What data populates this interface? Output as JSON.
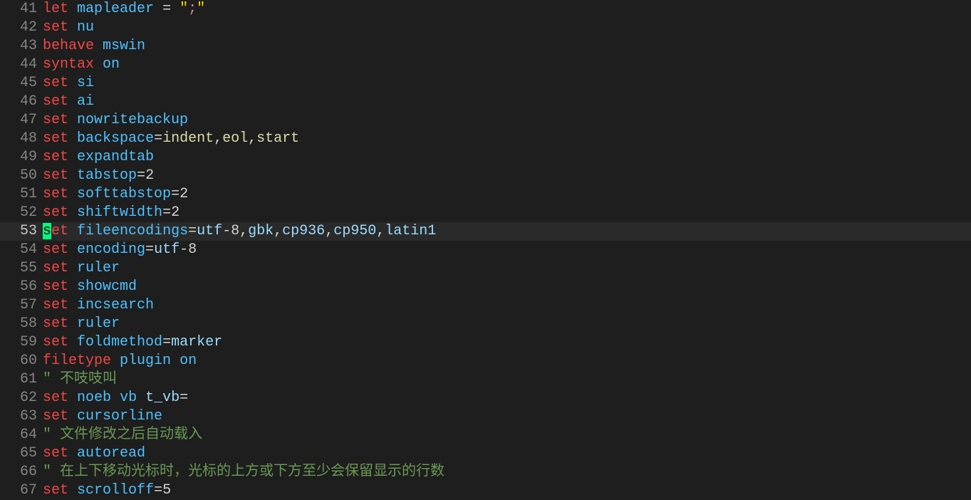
{
  "editor": {
    "current_line": 53,
    "first_line": 41,
    "lines": [
      {
        "n": 41,
        "tokens": [
          [
            "kw",
            "let"
          ],
          [
            "plain",
            " "
          ],
          [
            "opt",
            "mapleader"
          ],
          [
            "plain",
            " "
          ],
          [
            "op",
            "="
          ],
          [
            "plain",
            " "
          ],
          [
            "brk",
            "\""
          ],
          [
            "str",
            ";"
          ],
          [
            "brk",
            "\""
          ]
        ]
      },
      {
        "n": 42,
        "tokens": [
          [
            "kw",
            "set"
          ],
          [
            "plain",
            " "
          ],
          [
            "opt",
            "nu"
          ]
        ]
      },
      {
        "n": 43,
        "tokens": [
          [
            "kw",
            "behave"
          ],
          [
            "plain",
            " "
          ],
          [
            "opt",
            "mswin"
          ]
        ]
      },
      {
        "n": 44,
        "tokens": [
          [
            "kw",
            "syntax"
          ],
          [
            "plain",
            " "
          ],
          [
            "opt",
            "on"
          ]
        ]
      },
      {
        "n": 45,
        "tokens": [
          [
            "kw",
            "set"
          ],
          [
            "plain",
            " "
          ],
          [
            "opt",
            "si"
          ]
        ]
      },
      {
        "n": 46,
        "tokens": [
          [
            "kw",
            "set"
          ],
          [
            "plain",
            " "
          ],
          [
            "opt",
            "ai"
          ]
        ]
      },
      {
        "n": 47,
        "tokens": [
          [
            "kw",
            "set"
          ],
          [
            "plain",
            " "
          ],
          [
            "opt",
            "nowritebackup"
          ]
        ]
      },
      {
        "n": 48,
        "tokens": [
          [
            "kw",
            "set"
          ],
          [
            "plain",
            " "
          ],
          [
            "opt",
            "backspace"
          ],
          [
            "op",
            "="
          ],
          [
            "fn",
            "indent"
          ],
          [
            "op",
            ","
          ],
          [
            "fn",
            "eol"
          ],
          [
            "op",
            ","
          ],
          [
            "fn",
            "start"
          ]
        ]
      },
      {
        "n": 49,
        "tokens": [
          [
            "kw",
            "set"
          ],
          [
            "plain",
            " "
          ],
          [
            "opt",
            "expandtab"
          ]
        ]
      },
      {
        "n": 50,
        "tokens": [
          [
            "kw",
            "set"
          ],
          [
            "plain",
            " "
          ],
          [
            "opt",
            "tabstop"
          ],
          [
            "op",
            "="
          ],
          [
            "plain",
            "2"
          ]
        ]
      },
      {
        "n": 51,
        "tokens": [
          [
            "kw",
            "set"
          ],
          [
            "plain",
            " "
          ],
          [
            "opt",
            "softtabstop"
          ],
          [
            "op",
            "="
          ],
          [
            "plain",
            "2"
          ]
        ]
      },
      {
        "n": 52,
        "tokens": [
          [
            "kw",
            "set"
          ],
          [
            "plain",
            " "
          ],
          [
            "opt",
            "shiftwidth"
          ],
          [
            "op",
            "="
          ],
          [
            "plain",
            "2"
          ]
        ]
      },
      {
        "n": 53,
        "cursor_at": 0,
        "tokens": [
          [
            "kw",
            "set"
          ],
          [
            "plain",
            " "
          ],
          [
            "opt",
            "fileencodings"
          ],
          [
            "op",
            "="
          ],
          [
            "id",
            "utf"
          ],
          [
            "plain",
            "-8"
          ],
          [
            "op",
            ","
          ],
          [
            "id",
            "gbk"
          ],
          [
            "op",
            ","
          ],
          [
            "id",
            "cp936"
          ],
          [
            "op",
            ","
          ],
          [
            "id",
            "cp950"
          ],
          [
            "op",
            ","
          ],
          [
            "id",
            "latin1"
          ]
        ]
      },
      {
        "n": 54,
        "tokens": [
          [
            "kw",
            "set"
          ],
          [
            "plain",
            " "
          ],
          [
            "opt",
            "encoding"
          ],
          [
            "op",
            "="
          ],
          [
            "id",
            "utf"
          ],
          [
            "plain",
            "-8"
          ]
        ]
      },
      {
        "n": 55,
        "tokens": [
          [
            "kw",
            "set"
          ],
          [
            "plain",
            " "
          ],
          [
            "opt",
            "ruler"
          ]
        ]
      },
      {
        "n": 56,
        "tokens": [
          [
            "kw",
            "set"
          ],
          [
            "plain",
            " "
          ],
          [
            "opt",
            "showcmd"
          ]
        ]
      },
      {
        "n": 57,
        "tokens": [
          [
            "kw",
            "set"
          ],
          [
            "plain",
            " "
          ],
          [
            "opt",
            "incsearch"
          ]
        ]
      },
      {
        "n": 58,
        "tokens": [
          [
            "kw",
            "set"
          ],
          [
            "plain",
            " "
          ],
          [
            "opt",
            "ruler"
          ]
        ]
      },
      {
        "n": 59,
        "tokens": [
          [
            "kw",
            "set"
          ],
          [
            "plain",
            " "
          ],
          [
            "opt",
            "foldmethod"
          ],
          [
            "op",
            "="
          ],
          [
            "id",
            "marker"
          ]
        ]
      },
      {
        "n": 60,
        "tokens": [
          [
            "kw",
            "filetype"
          ],
          [
            "plain",
            " "
          ],
          [
            "opt",
            "plugin"
          ],
          [
            "plain",
            " "
          ],
          [
            "opt",
            "on"
          ]
        ]
      },
      {
        "n": 61,
        "tokens": [
          [
            "cmt",
            "\" 不吱吱叫"
          ]
        ]
      },
      {
        "n": 62,
        "tokens": [
          [
            "kw",
            "set"
          ],
          [
            "plain",
            " "
          ],
          [
            "opt",
            "noeb"
          ],
          [
            "plain",
            " "
          ],
          [
            "opt",
            "vb"
          ],
          [
            "plain",
            " "
          ],
          [
            "id",
            "t_vb"
          ],
          [
            "op",
            "="
          ]
        ]
      },
      {
        "n": 63,
        "tokens": [
          [
            "kw",
            "set"
          ],
          [
            "plain",
            " "
          ],
          [
            "opt",
            "cursorline"
          ]
        ]
      },
      {
        "n": 64,
        "tokens": [
          [
            "cmt",
            "\" 文件修改之后自动载入"
          ]
        ]
      },
      {
        "n": 65,
        "tokens": [
          [
            "kw",
            "set"
          ],
          [
            "plain",
            " "
          ],
          [
            "opt",
            "autoread"
          ]
        ]
      },
      {
        "n": 66,
        "tokens": [
          [
            "cmt",
            "\" 在上下移动光标时，光标的上方或下方至少会保留显示的行数"
          ]
        ]
      },
      {
        "n": 67,
        "tokens": [
          [
            "kw",
            "set"
          ],
          [
            "plain",
            " "
          ],
          [
            "opt",
            "scrolloff"
          ],
          [
            "op",
            "="
          ],
          [
            "plain",
            "5"
          ]
        ]
      }
    ]
  }
}
